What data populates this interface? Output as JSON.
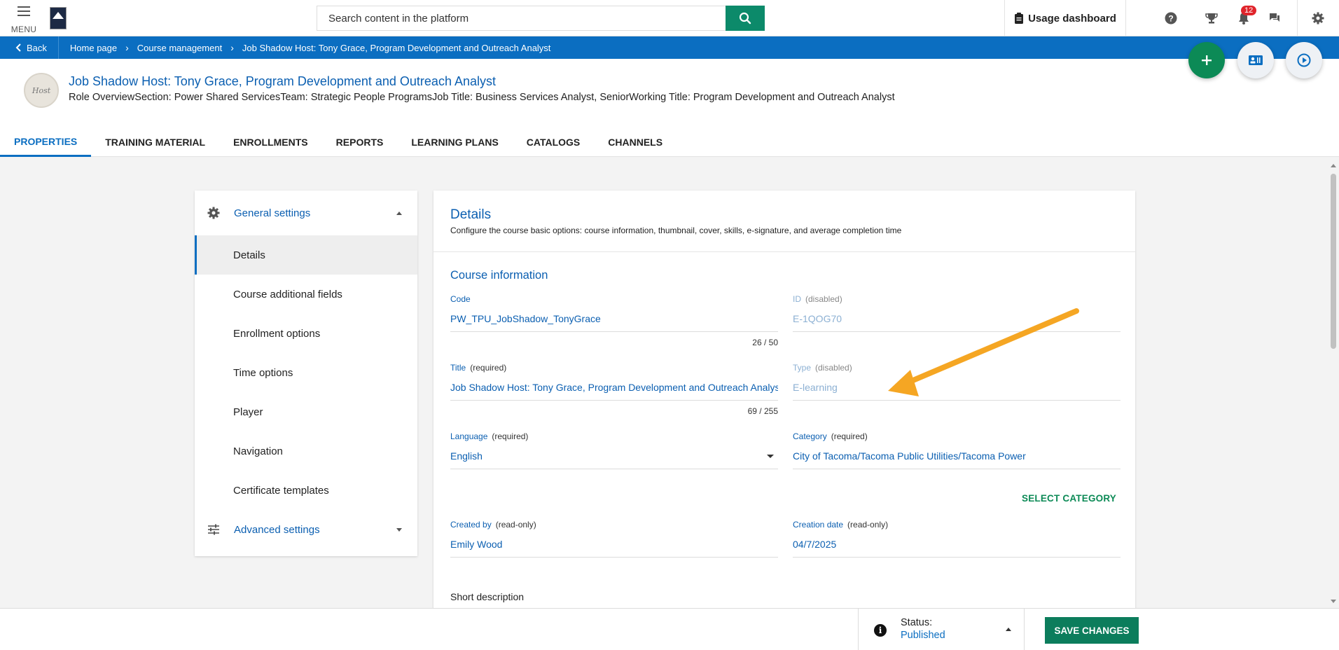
{
  "topbar": {
    "menu_label": "MENU",
    "search_placeholder": "Search content in the platform",
    "usage_label": "Usage dashboard",
    "notification_count": "12"
  },
  "breadcrumb": {
    "back_label": "Back",
    "items": [
      "Home page",
      "Course management",
      "Job Shadow Host: Tony Grace, Program Development and Outreach Analyst"
    ]
  },
  "header": {
    "avatar_text": "Host",
    "title": "Job Shadow Host: Tony Grace, Program Development and Outreach Analyst",
    "subtitle": "Role OverviewSection: Power Shared ServicesTeam: Strategic People ProgramsJob Title: Business Services Analyst, SeniorWorking Title: Program Development and Outreach Analyst",
    "tabs": [
      "PROPERTIES",
      "TRAINING MATERIAL",
      "ENROLLMENTS",
      "REPORTS",
      "LEARNING PLANS",
      "CATALOGS",
      "CHANNELS"
    ]
  },
  "leftmenu": {
    "general": "General settings",
    "items": [
      "Details",
      "Course additional fields",
      "Enrollment options",
      "Time options",
      "Player",
      "Navigation",
      "Certificate templates"
    ],
    "advanced": "Advanced settings"
  },
  "details": {
    "title": "Details",
    "description": "Configure the course basic options: course information, thumbnail, cover, skills, e-signature, and average completion time",
    "section": "Course information",
    "code": {
      "label": "Code",
      "value": "PW_TPU_JobShadow_TonyGrace",
      "count": "26 / 50"
    },
    "id": {
      "label": "ID",
      "note": "(disabled)",
      "value": "E-1QOG70"
    },
    "title_field": {
      "label": "Title",
      "note": "(required)",
      "value": "Job Shadow Host: Tony Grace, Program Development and Outreach Analyst",
      "count": "69 / 255"
    },
    "type": {
      "label": "Type",
      "note": "(disabled)",
      "value": "E-learning"
    },
    "language": {
      "label": "Language",
      "note": "(required)",
      "value": "English"
    },
    "category": {
      "label": "Category",
      "note": "(required)",
      "value": "City of Tacoma/Tacoma Public Utilities/Tacoma Power"
    },
    "select_category": "SELECT CATEGORY",
    "created_by": {
      "label": "Created by",
      "note": "(read-only)",
      "value": "Emily Wood"
    },
    "creation_date": {
      "label": "Creation date",
      "note": "(read-only)",
      "value": "04/7/2025"
    },
    "short_description": "Short description"
  },
  "bottombar": {
    "status_label": "Status:",
    "status_value": "Published",
    "save_label": "SAVE CHANGES"
  },
  "colors": {
    "primary_blue": "#0b6ec1",
    "green": "#0c8a56",
    "arrow_orange": "#f5a623"
  }
}
